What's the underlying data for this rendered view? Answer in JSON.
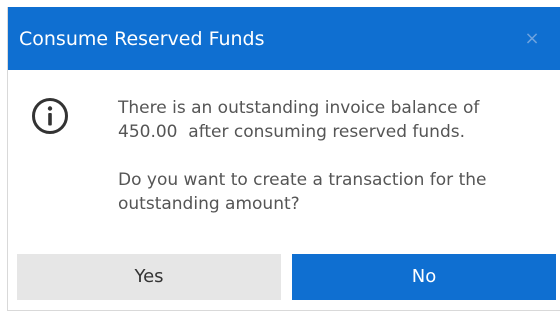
{
  "dialog": {
    "title": "Consume Reserved Funds",
    "close_glyph": "×",
    "icon": "info-circle-icon",
    "message_line1": "There is an outstanding invoice balance of",
    "message_line2": "450.00  after consuming reserved funds.",
    "question_line1": "Do you want to create a transaction for the",
    "question_line2": "outstanding amount?",
    "buttons": {
      "yes_label": "Yes",
      "no_label": "No"
    }
  },
  "colors": {
    "accent": "#0f6fd1",
    "secondary_button": "#e6e6e6",
    "text": "#555555"
  }
}
